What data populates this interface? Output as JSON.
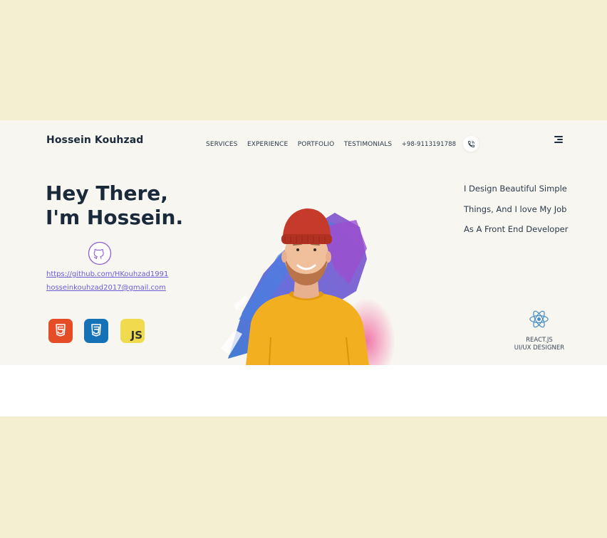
{
  "brand": "Hossein Kouhzad",
  "nav": {
    "services": "SERVICES",
    "experience": "EXPERIENCE",
    "portfolio": "PORTFOLIO",
    "testimonials": "TESTIMONIALS",
    "phone": "+98-9113191788"
  },
  "hero": {
    "line1": "Hey There,",
    "line2": "I'm Hossein.",
    "github_url": "https://github.com/HKouhzad1991",
    "email": "hosseinkouhzad2017@gmail.com",
    "tagline": [
      "I Design Beautiful Simple",
      "Things, And I love My Job",
      "As A Front End Developer"
    ],
    "role1": "REACT.JS",
    "role2": "UI/UX DESIGNER"
  },
  "icons": {
    "call": "phone-icon",
    "menu": "hamburger-menu-icon",
    "github": "github-icon",
    "html": "html5-icon",
    "css": "css3-icon",
    "js": "javascript-icon",
    "js_text": "JS",
    "react": "react-icon"
  },
  "colors": {
    "page_bg": "#f5efd2",
    "hero_bg": "#f8f6f1",
    "link": "#6a5bd6",
    "html5": "#e44d26",
    "css3": "#1572b6",
    "js": "#f0db4f",
    "sweater": "#f2b021",
    "beanie": "#c53a2a"
  }
}
